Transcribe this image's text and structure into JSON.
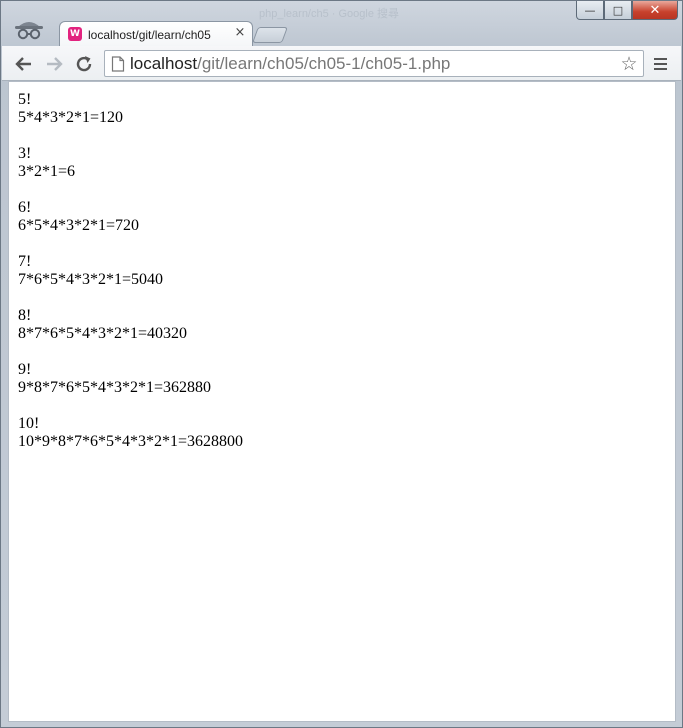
{
  "browser": {
    "tab": {
      "title": "localhost/git/learn/ch05",
      "favicon": "W"
    },
    "ghost_tab": "php_learn/ch5 · Google 搜尋",
    "url": {
      "host": "localhost",
      "path": "/git/learn/ch05/ch05-1/ch05-1.php"
    },
    "window_buttons": {
      "minimize": "—",
      "maximize": "□",
      "close": "✕"
    },
    "tab_close": "×",
    "star": "☆"
  },
  "page": {
    "blocks": [
      {
        "label": "5!",
        "expr": "5*4*3*2*1=120"
      },
      {
        "label": "3!",
        "expr": "3*2*1=6"
      },
      {
        "label": "6!",
        "expr": "6*5*4*3*2*1=720"
      },
      {
        "label": "7!",
        "expr": "7*6*5*4*3*2*1=5040"
      },
      {
        "label": "8!",
        "expr": "8*7*6*5*4*3*2*1=40320"
      },
      {
        "label": "9!",
        "expr": "9*8*7*6*5*4*3*2*1=362880"
      },
      {
        "label": "10!",
        "expr": "10*9*8*7*6*5*4*3*2*1=3628800"
      }
    ]
  },
  "colors": {
    "favicon": "#e2237f",
    "close_button": "#c8412c"
  }
}
